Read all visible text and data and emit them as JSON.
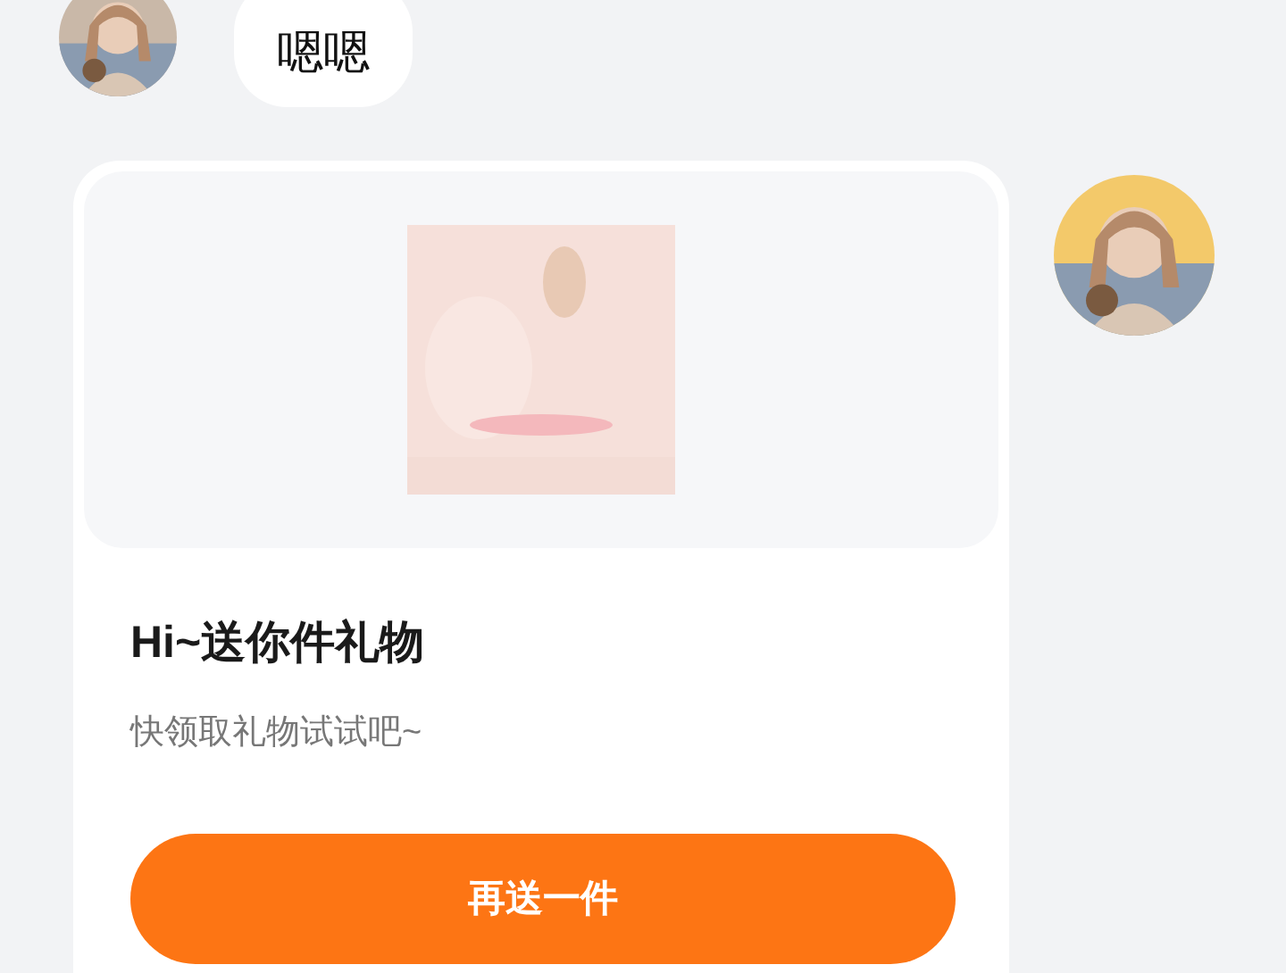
{
  "messages": [
    {
      "text": "嗯嗯"
    }
  ],
  "gift_card": {
    "title": "Hi~送你件礼物",
    "subtitle": "快领取礼物试试吧~",
    "button": "再送一件"
  }
}
